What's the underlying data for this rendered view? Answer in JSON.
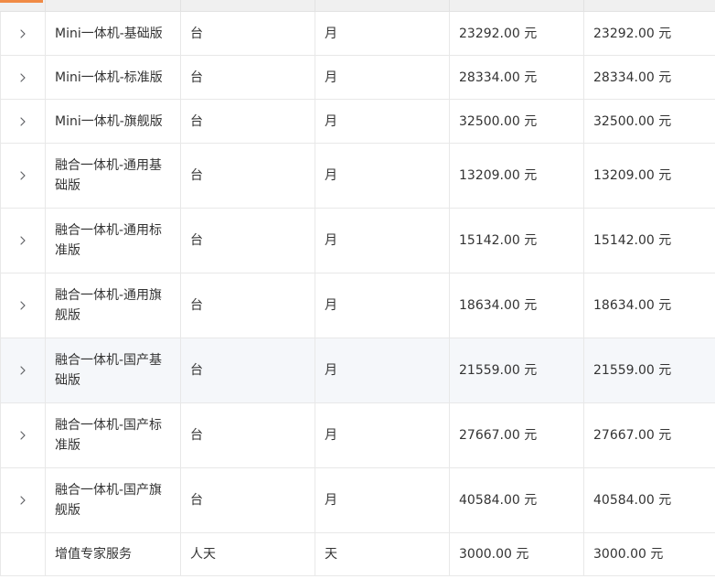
{
  "table": {
    "rows": [
      {
        "name": "Mini一体机-基础版",
        "unit": "台",
        "period": "月",
        "unit_price": "23292.00 元",
        "total_price": "23292.00 元",
        "expandable": true
      },
      {
        "name": "Mini一体机-标准版",
        "unit": "台",
        "period": "月",
        "unit_price": "28334.00 元",
        "total_price": "28334.00 元",
        "expandable": true
      },
      {
        "name": "Mini一体机-旗舰版",
        "unit": "台",
        "period": "月",
        "unit_price": "32500.00 元",
        "total_price": "32500.00 元",
        "expandable": true
      },
      {
        "name": "融合一体机-通用基础版",
        "unit": "台",
        "period": "月",
        "unit_price": "13209.00 元",
        "total_price": "13209.00 元",
        "expandable": true
      },
      {
        "name": "融合一体机-通用标准版",
        "unit": "台",
        "period": "月",
        "unit_price": "15142.00 元",
        "total_price": "15142.00 元",
        "expandable": true
      },
      {
        "name": "融合一体机-通用旗舰版",
        "unit": "台",
        "period": "月",
        "unit_price": "18634.00 元",
        "total_price": "18634.00 元",
        "expandable": true
      },
      {
        "name": "融合一体机-国产基础版",
        "unit": "台",
        "period": "月",
        "unit_price": "21559.00 元",
        "total_price": "21559.00 元",
        "expandable": true
      },
      {
        "name": "融合一体机-国产标准版",
        "unit": "台",
        "period": "月",
        "unit_price": "27667.00 元",
        "total_price": "27667.00 元",
        "expandable": true
      },
      {
        "name": "融合一体机-国产旗舰版",
        "unit": "台",
        "period": "月",
        "unit_price": "40584.00 元",
        "total_price": "40584.00 元",
        "expandable": true
      },
      {
        "name": "增值专家服务",
        "unit": "人天",
        "period": "天",
        "unit_price": "3000.00 元",
        "total_price": "3000.00 元",
        "expandable": false
      }
    ]
  },
  "colors": {
    "accent": "#f08a45",
    "border": "#e8e8e8",
    "hover_row": "#f5f7fa",
    "text": "#333333"
  },
  "icons": {
    "expand": "chevron-right-icon"
  }
}
